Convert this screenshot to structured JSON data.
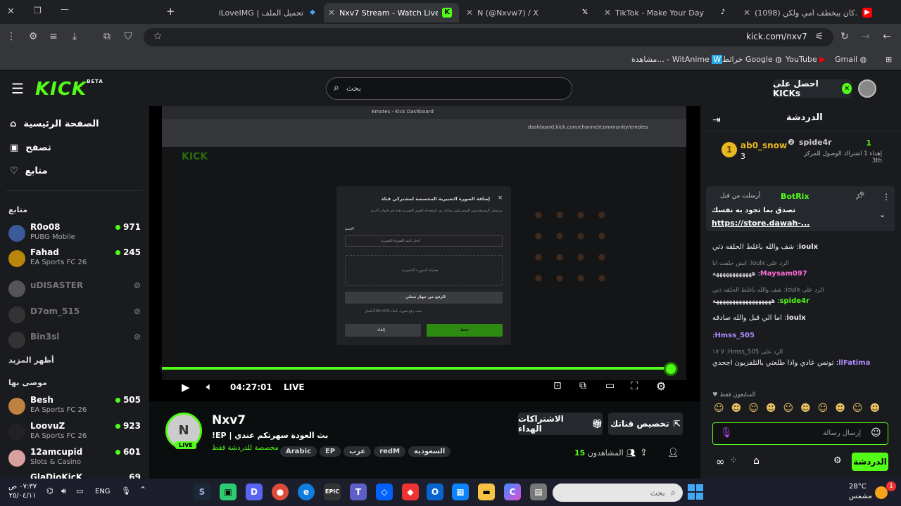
{
  "browser": {
    "tabs": [
      {
        "title": "(1098) كان بيخطف امي ولكن...",
        "icon": "youtube-icon"
      },
      {
        "title": "TikTok - Make Your Day",
        "icon": "tiktok-icon"
      },
      {
        "title": "N (@Nxvw7) / X",
        "icon": "x-icon"
      },
      {
        "title": "Nxv7 Stream - Watch Live on Kick",
        "icon": "kick-icon"
      },
      {
        "title": "iLoveIMG | تحميل الملف",
        "icon": "diamond-icon"
      }
    ],
    "new_tab": "+",
    "url": "kick.com/nxv7",
    "bookmarks": [
      "Gmail",
      "YouTube",
      "خرائط Google",
      "مشاهدة... - WitAnime"
    ]
  },
  "header": {
    "logo": "KICK",
    "logo_badge": "BETA",
    "search_placeholder": "بحث",
    "get_kicks": "احصل على KICKs"
  },
  "sidebar": {
    "nav": [
      {
        "label": "الصفحة الرئيسية",
        "icon": "home-icon"
      },
      {
        "label": "تصفح",
        "icon": "browse-icon"
      },
      {
        "label": "متابع",
        "icon": "heart-icon"
      }
    ],
    "following_title": "متابع",
    "following": [
      {
        "name": "R0o08",
        "game": "PUBG Mobile",
        "viewers": "971",
        "live": true
      },
      {
        "name": "Fahad",
        "game": "EA Sports FC 26",
        "viewers": "245",
        "live": true
      },
      {
        "name": "uDISASTER",
        "game": "",
        "viewers": "",
        "live": false
      },
      {
        "name": "D7om_515",
        "game": "",
        "viewers": "",
        "live": false
      },
      {
        "name": "Bin3sl",
        "game": "",
        "viewers": "",
        "live": false
      }
    ],
    "show_more": "أظهر المزيد",
    "recommended_title": "موصى بها",
    "recommended": [
      {
        "name": "Besh",
        "game": "EA Sports FC 26",
        "viewers": "505"
      },
      {
        "name": "LoovuZ",
        "game": "EA Sports FC 26",
        "viewers": "923"
      },
      {
        "name": "12amcupid",
        "game": "Slots & Casino",
        "viewers": "601"
      },
      {
        "name": "GlaDioKicK",
        "game": "",
        "viewers": "69"
      }
    ]
  },
  "video": {
    "time": "04:27:01",
    "live_label": "LIVE",
    "progress": 0.97,
    "embedded": {
      "tab_title": "Emotes - Kick Dashboard",
      "url": "dashboard.kick.com/channel/community/emotes",
      "modal_title": "إضافة الصورة التعبيرية المخصصة لمشتركي قناة",
      "modal_desc": "سيتمكن المستخدمون المشتركون بقناتك من استخدام الصور التعبيرية هذه في قنوات أخرى",
      "name_label": "الاسم",
      "name_placeholder": "أدخل اسم الصورة التعبيرية",
      "preview_label": "معاينة الصورة التعبيرية",
      "upload_label": "الرفع من جهاز محلي",
      "hint": "يجب رفع صورة بأبعاد 500×500بكسل",
      "save_label": "حفظ",
      "cancel_label": "إلغاء"
    }
  },
  "stream": {
    "channel": "Nxv7",
    "title": "بث العودة سهرتكم عندي | EP!",
    "subscribers_only": "مخصصة للدردشة فقط",
    "tags": [
      "Arabic",
      "EP",
      "عرب",
      "redM",
      "السعودية"
    ],
    "viewers": "15",
    "viewers_label": "المشاهدون",
    "live_badge": "LIVE",
    "gift_subs": "الاشتراكات الهداء",
    "customize": "تخصيص قناتك"
  },
  "chat": {
    "title": "الدردشة",
    "leaderboard": [
      {
        "rank": "1",
        "name": "spide4r",
        "note": "إهداء 1 اشتراك الوصول للمركز 3th"
      },
      {
        "rank": "1",
        "name": "ab0_snow",
        "count": "3"
      }
    ],
    "pinned": {
      "by": "أرسلت من قبل",
      "user": "BotRix",
      "text": "تصدق بما تجود به نفسك",
      "link": "https://store.dawah-..."
    },
    "messages": [
      {
        "user": "ioulx",
        "text": "شف والله باغلط الحلقه ذتي"
      },
      {
        "reply": "الرد على ioulx: ايش حلفت انا",
        "user": "Maysam097",
        "text": "ههههههههههههه"
      },
      {
        "reply": "الرد على ioulx: شف والله باغلط الحلقه ذتي",
        "user": "spide4r",
        "text": "ههههههههههههههههههه"
      },
      {
        "user": "ioulx",
        "text": "اما الي قبل والله صادقه"
      },
      {
        "user": "Hmss_505",
        "text": ""
      },
      {
        "reply": "الرد على Hmss_505: لا ١٧",
        "user": "llFatima",
        "text": "تونس عادي واذا طلعتي بالتلفزيون اجحدي"
      }
    ],
    "followers_only": "المتابعون فقط",
    "input_placeholder": "إرسال رسالة",
    "send_label": "الدردشة"
  },
  "taskbar": {
    "search_placeholder": "بحث",
    "weather_temp": "28°C",
    "weather_desc": "مشمس",
    "lang": "ENG",
    "time": "٠٧:٣٧ ص",
    "date": "٢٥/٠٤/١١",
    "notif_count": "1"
  }
}
